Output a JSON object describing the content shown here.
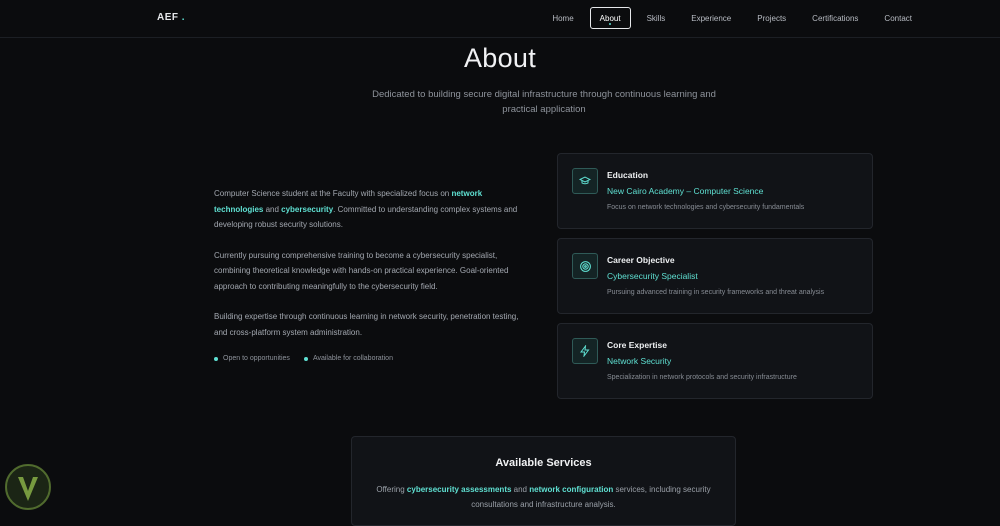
{
  "nav": {
    "brand": "AEF",
    "brand_dot": ".",
    "links": [
      "Home",
      "About",
      "Skills",
      "Experience",
      "Projects",
      "Certifications",
      "Contact"
    ],
    "active": "About"
  },
  "header": {
    "title": "About",
    "subtitle": "Dedicated to building secure digital infrastructure through continuous learning and practical application"
  },
  "about": {
    "p1": {
      "a": "Computer Science student at the Faculty with specialized focus on ",
      "hl1": "network technologies",
      "b": " and ",
      "hl2": "cybersecurity",
      "c": ". Committed to understanding complex systems and developing robust security solutions."
    },
    "p2": "Currently pursuing comprehensive training to become a cybersecurity specialist, combining theoretical knowledge with hands-on practical experience. Goal-oriented approach to contributing meaningfully to the cybersecurity field.",
    "p3": "Building expertise through continuous learning in network security, penetration testing, and cross-platform system administration.",
    "tags": [
      "Open to opportunities",
      "Available for collaboration"
    ]
  },
  "cards": [
    {
      "icon": "graduation-cap-icon",
      "title": "Education",
      "subtitle": "New Cairo Academy – Computer Science",
      "desc": "Focus on network technologies and cybersecurity fundamentals"
    },
    {
      "icon": "target-icon",
      "title": "Career Objective",
      "subtitle": "Cybersecurity Specialist",
      "desc": "Pursuing advanced training in security frameworks and threat analysis"
    },
    {
      "icon": "lightning-icon",
      "title": "Core Expertise",
      "subtitle": "Network Security",
      "desc": "Specialization in network protocols and security infrastructure"
    }
  ],
  "services": {
    "title": "Available Services",
    "a": "Offering ",
    "hl1": "cybersecurity assessments",
    "b": " and ",
    "hl2": "network configuration",
    "c": " services, including security consultations and infrastructure analysis."
  },
  "colors": {
    "background": "#0b0c0e",
    "accent": "#5fe0d2",
    "card": "#111317"
  }
}
